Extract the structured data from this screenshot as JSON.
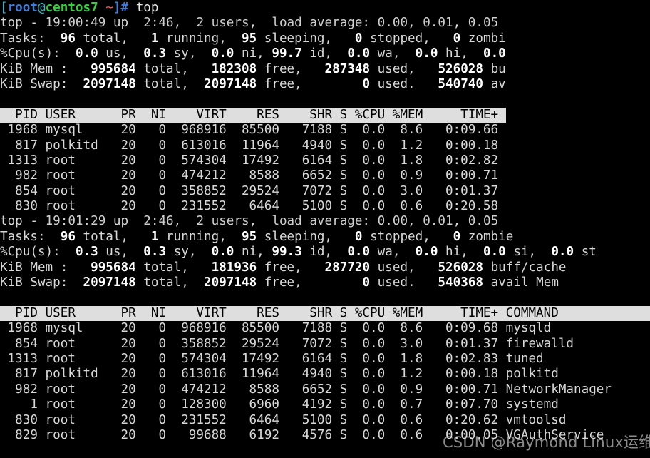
{
  "terminal": {
    "background_color": "#000000",
    "foreground_color": "#d8d8d8",
    "header_bar_bg": "#dedede",
    "header_bar_fg": "#000000",
    "prompt": {
      "bracket_open": "[",
      "user": "root",
      "at": "@",
      "host": "centos7",
      "space_path": " ~",
      "bracket_close": "]",
      "hash": "# ",
      "command": "top",
      "colors": {
        "bracket": "#2fb7c8",
        "user": "#3b7ddd",
        "host": "#2fd23a",
        "path": "#e05c5c",
        "hash": "#3b7ddd"
      }
    }
  },
  "top_run_1": {
    "summary": [
      "top - 19:00:49 up  2:46,  2 users,  load average: 0.00, 0.01, 0.05",
      "Tasks:  96 total,   1 running,  95 sleeping,   0 stopped,   0 zombi",
      "%Cpu(s):  0.0 us,  0.3 sy,  0.0 ni, 99.7 id,  0.0 wa,  0.0 hi,  0.0",
      "KiB Mem :   995684 total,   182308 free,   287348 used,   526028 bu",
      "KiB Swap:  2097148 total,  2097148 free,        0 used.   540740 av"
    ],
    "uptime_line": {
      "label": "top -",
      "time": "19:00:49",
      "up": "up",
      "uptime": "2:46,",
      "users": "2 users,",
      "load_label": "load average:",
      "load_1": "0.00",
      "load_5": "0.01",
      "load_15": "0.05"
    },
    "tasks": {
      "label": "Tasks:",
      "total": "96",
      "running": "1",
      "sleeping": "95",
      "stopped": "0",
      "zombie": "0",
      "zombie_label": "zombi"
    },
    "cpu": {
      "label": "%Cpu(s):",
      "us": "0.0",
      "sy": "0.3",
      "ni": "0.0",
      "id": "99.7",
      "wa": "0.0",
      "hi": "0.0",
      "si": "0.0"
    },
    "mem": {
      "label": "KiB Mem :",
      "total": "995684",
      "free": "182308",
      "used": "287348",
      "buff_cache": "526028",
      "buff_cache_label": "bu"
    },
    "swap": {
      "label": "KiB Swap:",
      "total": "2097148",
      "free": "2097148",
      "used": "0",
      "avail": "540740",
      "avail_label": "av"
    },
    "table": {
      "header": "  PID USER      PR  NI    VIRT    RES    SHR S %CPU %MEM     TIME+ ",
      "columns": [
        "PID",
        "USER",
        "PR",
        "NI",
        "VIRT",
        "RES",
        "SHR",
        "S",
        "%CPU",
        "%MEM",
        "TIME+"
      ],
      "rows": [
        " 1968 mysql     20   0  968916  85500   7188 S  0.0  8.6   0:09.66",
        "  817 polkitd   20   0  613016  11964   4940 S  0.0  1.2   0:00.18",
        " 1313 root      20   0  574304  17492   6164 S  0.0  1.8   0:02.82",
        "  982 root      20   0  474212   8588   6652 S  0.0  0.9   0:00.71",
        "  854 root      20   0  358852  29524   7072 S  0.0  3.0   0:01.37",
        "  830 root      20   0  231552   6464   5100 S  0.0  0.6   0:20.58"
      ],
      "rows_data": [
        {
          "pid": "1968",
          "user": "mysql",
          "pr": "20",
          "ni": "0",
          "virt": "968916",
          "res": "85500",
          "shr": "7188",
          "s": "S",
          "cpu": "0.0",
          "mem": "8.6",
          "time": "0:09.66"
        },
        {
          "pid": "817",
          "user": "polkitd",
          "pr": "20",
          "ni": "0",
          "virt": "613016",
          "res": "11964",
          "shr": "4940",
          "s": "S",
          "cpu": "0.0",
          "mem": "1.2",
          "time": "0:00.18"
        },
        {
          "pid": "1313",
          "user": "root",
          "pr": "20",
          "ni": "0",
          "virt": "574304",
          "res": "17492",
          "shr": "6164",
          "s": "S",
          "cpu": "0.0",
          "mem": "1.8",
          "time": "0:02.82"
        },
        {
          "pid": "982",
          "user": "root",
          "pr": "20",
          "ni": "0",
          "virt": "474212",
          "res": "8588",
          "shr": "6652",
          "s": "S",
          "cpu": "0.0",
          "mem": "0.9",
          "time": "0:00.71"
        },
        {
          "pid": "854",
          "user": "root",
          "pr": "20",
          "ni": "0",
          "virt": "358852",
          "res": "29524",
          "shr": "7072",
          "s": "S",
          "cpu": "0.0",
          "mem": "3.0",
          "time": "0:01.37"
        },
        {
          "pid": "830",
          "user": "root",
          "pr": "20",
          "ni": "0",
          "virt": "231552",
          "res": "6464",
          "shr": "5100",
          "s": "S",
          "cpu": "0.0",
          "mem": "0.6",
          "time": "0:20.58"
        }
      ]
    }
  },
  "top_run_2": {
    "summary": [
      "top - 19:01:29 up  2:46,  2 users,  load average: 0.00, 0.01, 0.05",
      "Tasks:  96 total,   1 running,  95 sleeping,   0 stopped,   0 zombie",
      "%Cpu(s):  0.3 us,  0.3 sy,  0.0 ni, 99.3 id,  0.0 wa,  0.0 hi,  0.0 si,  0.0 st",
      "KiB Mem :   995684 total,   181936 free,   287720 used,   526028 buff/cache",
      "KiB Swap:  2097148 total,  2097148 free,        0 used.   540368 avail Mem"
    ],
    "uptime_line": {
      "label": "top -",
      "time": "19:01:29",
      "up": "up",
      "uptime": "2:46,",
      "users": "2 users,",
      "load_label": "load average:",
      "load_1": "0.00",
      "load_5": "0.01",
      "load_15": "0.05"
    },
    "tasks": {
      "label": "Tasks:",
      "total": "96",
      "running": "1",
      "sleeping": "95",
      "stopped": "0",
      "zombie": "0",
      "zombie_label": "zombie"
    },
    "cpu": {
      "label": "%Cpu(s):",
      "us": "0.3",
      "sy": "0.3",
      "ni": "0.0",
      "id": "99.3",
      "wa": "0.0",
      "hi": "0.0",
      "si": "0.0",
      "st": "0.0"
    },
    "mem": {
      "label": "KiB Mem :",
      "total": "995684",
      "free": "181936",
      "used": "287720",
      "buff_cache": "526028",
      "buff_cache_label": "buff/cache"
    },
    "swap": {
      "label": "KiB Swap:",
      "total": "2097148",
      "free": "2097148",
      "used": "0",
      "avail": "540368",
      "avail_label": "avail Mem"
    },
    "table": {
      "header": "  PID USER      PR  NI    VIRT    RES    SHR S %CPU %MEM     TIME+ COMMAND                        ",
      "columns": [
        "PID",
        "USER",
        "PR",
        "NI",
        "VIRT",
        "RES",
        "SHR",
        "S",
        "%CPU",
        "%MEM",
        "TIME+",
        "COMMAND"
      ],
      "rows": [
        " 1968 mysql     20   0  968916  85500   7188 S  0.0  8.6   0:09.68 mysqld",
        "  854 root      20   0  358852  29524   7072 S  0.0  3.0   0:01.37 firewalld",
        " 1313 root      20   0  574304  17492   6164 S  0.0  1.8   0:02.83 tuned",
        "  817 polkitd   20   0  613016  11964   4940 S  0.0  1.2   0:00.18 polkitd",
        "  982 root      20   0  474212   8588   6652 S  0.0  0.9   0:00.71 NetworkManager",
        "    1 root      20   0  128300   6960   4192 S  0.0  0.7   0:07.70 systemd",
        "  830 root      20   0  231552   6464   5100 S  0.0  0.6   0:20.62 vmtoolsd",
        "  829 root      20   0   99688   6192   4576 S  0.0  0.6   0:00.05 VGAuthService"
      ],
      "rows_data": [
        {
          "pid": "1968",
          "user": "mysql",
          "pr": "20",
          "ni": "0",
          "virt": "968916",
          "res": "85500",
          "shr": "7188",
          "s": "S",
          "cpu": "0.0",
          "mem": "8.6",
          "time": "0:09.68",
          "command": "mysqld"
        },
        {
          "pid": "854",
          "user": "root",
          "pr": "20",
          "ni": "0",
          "virt": "358852",
          "res": "29524",
          "shr": "7072",
          "s": "S",
          "cpu": "0.0",
          "mem": "3.0",
          "time": "0:01.37",
          "command": "firewalld"
        },
        {
          "pid": "1313",
          "user": "root",
          "pr": "20",
          "ni": "0",
          "virt": "574304",
          "res": "17492",
          "shr": "6164",
          "s": "S",
          "cpu": "0.0",
          "mem": "1.8",
          "time": "0:02.83",
          "command": "tuned"
        },
        {
          "pid": "817",
          "user": "polkitd",
          "pr": "20",
          "ni": "0",
          "virt": "613016",
          "res": "11964",
          "shr": "4940",
          "s": "S",
          "cpu": "0.0",
          "mem": "1.2",
          "time": "0:00.18",
          "command": "polkitd"
        },
        {
          "pid": "982",
          "user": "root",
          "pr": "20",
          "ni": "0",
          "virt": "474212",
          "res": "8588",
          "shr": "6652",
          "s": "S",
          "cpu": "0.0",
          "mem": "0.9",
          "time": "0:00.71",
          "command": "NetworkManager"
        },
        {
          "pid": "1",
          "user": "root",
          "pr": "20",
          "ni": "0",
          "virt": "128300",
          "res": "6960",
          "shr": "4192",
          "s": "S",
          "cpu": "0.0",
          "mem": "0.7",
          "time": "0:07.70",
          "command": "systemd"
        },
        {
          "pid": "830",
          "user": "root",
          "pr": "20",
          "ni": "0",
          "virt": "231552",
          "res": "6464",
          "shr": "5100",
          "s": "S",
          "cpu": "0.0",
          "mem": "0.6",
          "time": "0:20.62",
          "command": "vmtoolsd"
        },
        {
          "pid": "829",
          "user": "root",
          "pr": "20",
          "ni": "0",
          "virt": "99688",
          "res": "6192",
          "shr": "4576",
          "s": "S",
          "cpu": "0.0",
          "mem": "0.6",
          "time": "0:00.05",
          "command": "VGAuthService"
        }
      ]
    }
  },
  "watermark": {
    "text": "CSDN @Raymond Linux运维"
  }
}
